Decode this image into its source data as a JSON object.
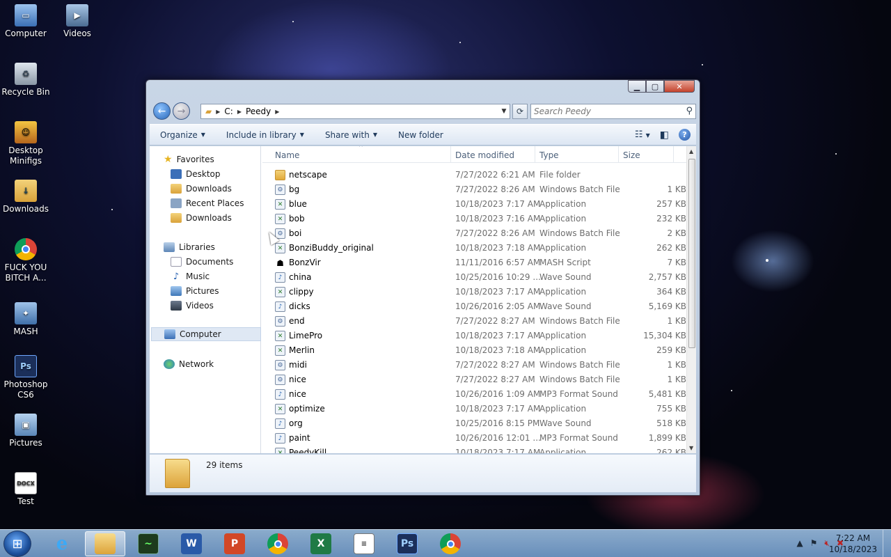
{
  "desktop": {
    "icons": [
      {
        "label": "Computer"
      },
      {
        "label": "Videos"
      },
      {
        "label": "Recycle Bin"
      },
      {
        "label": "Desktop Minifigs"
      },
      {
        "label": "Downloads"
      },
      {
        "label": "FUCK YOU BITCH A..."
      },
      {
        "label": "MASH"
      },
      {
        "label": "Photoshop CS6"
      },
      {
        "label": "Pictures"
      },
      {
        "label": "Test"
      }
    ]
  },
  "window": {
    "address": {
      "segments": [
        "C:",
        "Peedy"
      ]
    },
    "search": {
      "placeholder": "Search Peedy"
    },
    "toolbar": {
      "organize": "Organize",
      "include_in_library": "Include in library",
      "share_with": "Share with",
      "new_folder": "New folder"
    },
    "navpane": {
      "favorites": "Favorites",
      "favorites_items": [
        "Desktop",
        "Downloads",
        "Recent Places",
        "Downloads"
      ],
      "libraries": "Libraries",
      "libraries_items": [
        "Documents",
        "Music",
        "Pictures",
        "Videos"
      ],
      "computer": "Computer",
      "network": "Network"
    },
    "columns": {
      "name": "Name",
      "date_modified": "Date modified",
      "type": "Type",
      "size": "Size"
    },
    "files": [
      {
        "name": "netscape",
        "date": "7/27/2022 6:21 AM",
        "type": "File folder",
        "size": "",
        "icon": "folder-icon"
      },
      {
        "name": "bg",
        "date": "7/27/2022 8:26 AM",
        "type": "Windows Batch File",
        "size": "1 KB",
        "icon": "batch-file-icon"
      },
      {
        "name": "blue",
        "date": "10/18/2023 7:17 AM",
        "type": "Application",
        "size": "257 KB",
        "icon": "application-icon"
      },
      {
        "name": "bob",
        "date": "10/18/2023 7:16 AM",
        "type": "Application",
        "size": "232 KB",
        "icon": "application-icon"
      },
      {
        "name": "boi",
        "date": "7/27/2022 8:26 AM",
        "type": "Windows Batch File",
        "size": "2 KB",
        "icon": "batch-file-icon"
      },
      {
        "name": "BonziBuddy_original",
        "date": "10/18/2023 7:18 AM",
        "type": "Application",
        "size": "262 KB",
        "icon": "application-icon"
      },
      {
        "name": "BonzVir",
        "date": "11/11/2016 6:57 AM",
        "type": "MASH Script",
        "size": "7 KB",
        "icon": "mash-script-icon"
      },
      {
        "name": "china",
        "date": "10/25/2016 10:29 ...",
        "type": "Wave Sound",
        "size": "2,757 KB",
        "icon": "sound-file-icon"
      },
      {
        "name": "clippy",
        "date": "10/18/2023 7:17 AM",
        "type": "Application",
        "size": "364 KB",
        "icon": "application-icon"
      },
      {
        "name": "dicks",
        "date": "10/26/2016 2:05 AM",
        "type": "Wave Sound",
        "size": "5,169 KB",
        "icon": "sound-file-icon"
      },
      {
        "name": "end",
        "date": "7/27/2022 8:27 AM",
        "type": "Windows Batch File",
        "size": "1 KB",
        "icon": "batch-file-icon"
      },
      {
        "name": "LimePro",
        "date": "10/18/2023 7:17 AM",
        "type": "Application",
        "size": "15,304 KB",
        "icon": "application-icon"
      },
      {
        "name": "Merlin",
        "date": "10/18/2023 7:18 AM",
        "type": "Application",
        "size": "259 KB",
        "icon": "application-icon"
      },
      {
        "name": "midi",
        "date": "7/27/2022 8:27 AM",
        "type": "Windows Batch File",
        "size": "1 KB",
        "icon": "batch-file-icon"
      },
      {
        "name": "nice",
        "date": "7/27/2022 8:27 AM",
        "type": "Windows Batch File",
        "size": "1 KB",
        "icon": "batch-file-icon"
      },
      {
        "name": "nice",
        "date": "10/26/2016 1:09 AM",
        "type": "MP3 Format Sound",
        "size": "5,481 KB",
        "icon": "sound-file-icon"
      },
      {
        "name": "optimize",
        "date": "10/18/2023 7:17 AM",
        "type": "Application",
        "size": "755 KB",
        "icon": "application-icon"
      },
      {
        "name": "org",
        "date": "10/25/2016 8:15 PM",
        "type": "Wave Sound",
        "size": "518 KB",
        "icon": "sound-file-icon"
      },
      {
        "name": "paint",
        "date": "10/26/2016 12:01 ...",
        "type": "MP3 Format Sound",
        "size": "1,899 KB",
        "icon": "sound-file-icon"
      },
      {
        "name": "PeedyKill",
        "date": "10/18/2023 7:17 AM",
        "type": "Application",
        "size": "262 KB",
        "icon": "application-icon"
      }
    ],
    "details": {
      "count": "29 items"
    }
  },
  "taskbar": {
    "clock_time": "7:22 AM",
    "clock_date": "10/18/2023"
  }
}
